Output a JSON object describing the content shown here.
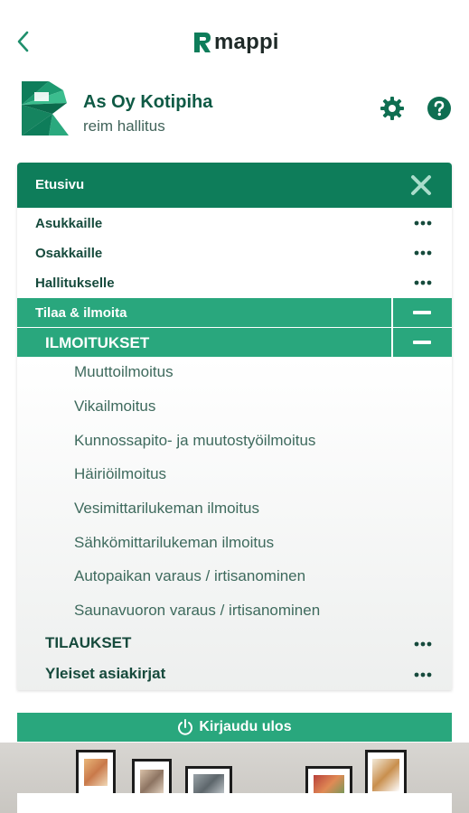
{
  "app": {
    "brand_name": "mappi",
    "accent_color": "#0e7d5a",
    "light_accent_color": "#29a77d"
  },
  "topbar": {
    "back_icon": "chevron-left-icon"
  },
  "header": {
    "company_name": "As Oy Kotipiha",
    "subtitle": "reim hallitus",
    "settings_icon": "gear-icon",
    "help_icon": "help-icon"
  },
  "menu": {
    "title": "Etusivu",
    "close_icon": "close-icon",
    "items": [
      {
        "label": "Asukkaille"
      },
      {
        "label": "Osakkaille"
      },
      {
        "label": "Hallitukselle"
      }
    ],
    "expanded_section": {
      "label": "Tilaa & ilmoita",
      "subsection": {
        "label": "ILMOITUKSET",
        "items": [
          "Muuttoilmoitus",
          "Vikailmoitus",
          "Kunnossapito- ja muutostyöilmoitus",
          "Häiriöilmoitus",
          "Vesimittarilukeman ilmoitus",
          "Sähkömittarilukeman ilmoitus",
          "Autopaikan varaus / irtisanominen",
          "Saunavuoron varaus / irtisanominen"
        ]
      },
      "other_sections": [
        {
          "label": "TILAUKSET"
        },
        {
          "label": "Yleiset asiakirjat"
        }
      ]
    }
  },
  "logout": {
    "label": "Kirjaudu ulos",
    "icon": "power-icon"
  }
}
